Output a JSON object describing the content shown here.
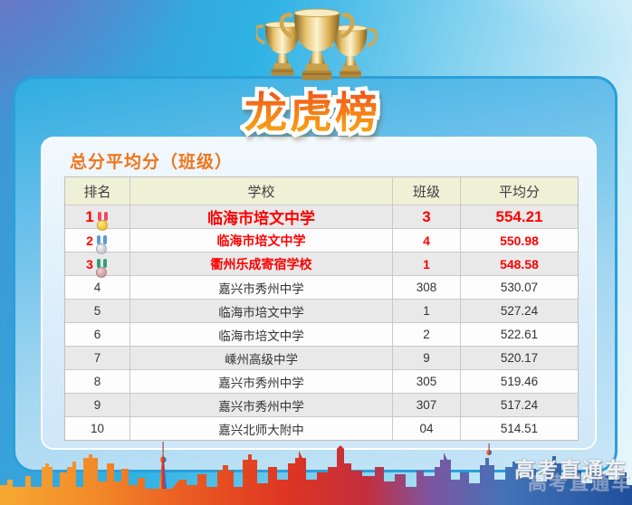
{
  "title": "龙虎榜",
  "subtitle": "总分平均分（班级）",
  "watermark": "高考直通车",
  "chart_data": {
    "type": "table",
    "title": "龙虎榜",
    "subtitle": "总分平均分（班级）",
    "columns": [
      "排名",
      "学校",
      "班级",
      "平均分"
    ],
    "rows": [
      {
        "rank": 1,
        "school": "临海市培文中学",
        "class": "3",
        "score": "554.21"
      },
      {
        "rank": 2,
        "school": "临海市培文中学",
        "class": "4",
        "score": "550.98"
      },
      {
        "rank": 3,
        "school": "衢州乐成寄宿学校",
        "class": "1",
        "score": "548.58"
      },
      {
        "rank": 4,
        "school": "嘉兴市秀州中学",
        "class": "308",
        "score": "530.07"
      },
      {
        "rank": 5,
        "school": "临海市培文中学",
        "class": "1",
        "score": "527.24"
      },
      {
        "rank": 6,
        "school": "临海市培文中学",
        "class": "2",
        "score": "522.61"
      },
      {
        "rank": 7,
        "school": "嵊州高级中学",
        "class": "9",
        "score": "520.17"
      },
      {
        "rank": 8,
        "school": "嘉兴市秀州中学",
        "class": "305",
        "score": "519.46"
      },
      {
        "rank": 9,
        "school": "嘉兴市秀州中学",
        "class": "307",
        "score": "517.24"
      },
      {
        "rank": 10,
        "school": "嘉兴北师大附中",
        "class": "04",
        "score": "514.51"
      }
    ]
  },
  "icons": {
    "trophies": "three-gold-trophy-cups",
    "rank1": "gold-medal-icon",
    "rank2": "silver-medal-icon",
    "rank3": "bronze-medal-icon",
    "footer": "city-skyline-graphic"
  },
  "colors": {
    "accent-orange": "#f0751c",
    "title-top": "#ee4a1c",
    "title-bottom": "#fbab14",
    "highlight-red": "#fe0000",
    "header-bg": "#eff1d7",
    "row-alt-bg": "#e9e9e9",
    "panel-border-blue": "#2b9fd9",
    "medal-gold": "#f5c231",
    "medal-silver": "#c3c9d2",
    "medal-bronze": "#cf9aa0",
    "ribbon-red": "#ef4a5e",
    "ribbon-blue": "#5b9bd7",
    "ribbon-green": "#2fa07c"
  }
}
